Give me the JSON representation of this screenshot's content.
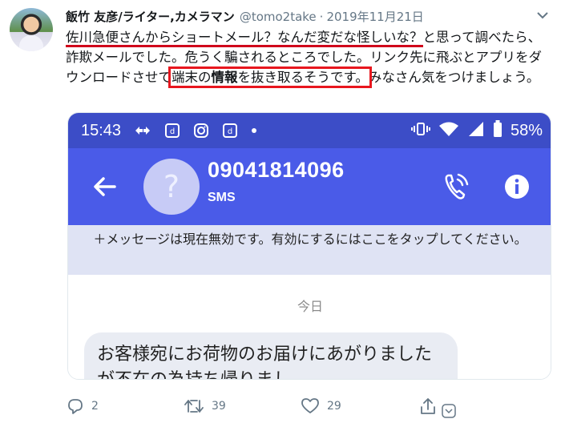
{
  "tweet": {
    "display_name": "飯竹 友彦/ライター,カメラマン",
    "handle": "@tomo2take",
    "separator": "·",
    "date": "2019年11月21日",
    "text": {
      "underlined": "佐川急便さんからショートメール？なんだ変だな怪しいな？",
      "part1": "と思って調べたら、詐欺メールでした。危うく騙されるところでした。リンク先に飛ぶとアプリをダウンロードさせて",
      "boxed_a": "端末の",
      "boxed_bold": "情報",
      "boxed_b": "を抜き取るそうです。",
      "part2": "みなさん気をつけましょう。"
    }
  },
  "screenshot": {
    "status_time": "15:43",
    "battery": "58%",
    "contact_avatar_glyph": "?",
    "phone_number": "09041814096",
    "sms_label": "SMS",
    "notice": "＋メッセージは現在無効です。有効にするにはここをタップしてください。",
    "day": "今日",
    "message_preview": "お客様宛にお荷物のお届けにあがりましたが不在の為持ち帰りまし"
  },
  "actions": {
    "reply_count": "2",
    "retweet_count": "39",
    "like_count": "29"
  },
  "icons": [
    "caret-down-icon",
    "back-arrow-icon",
    "call-icon",
    "info-icon",
    "reply-icon",
    "retweet-icon",
    "like-icon",
    "share-icon",
    "dm-icon"
  ],
  "colors": {
    "app_blue": "#4a5be8",
    "status_blue": "#3c4dc7",
    "annotation_red": "#e8161e"
  }
}
